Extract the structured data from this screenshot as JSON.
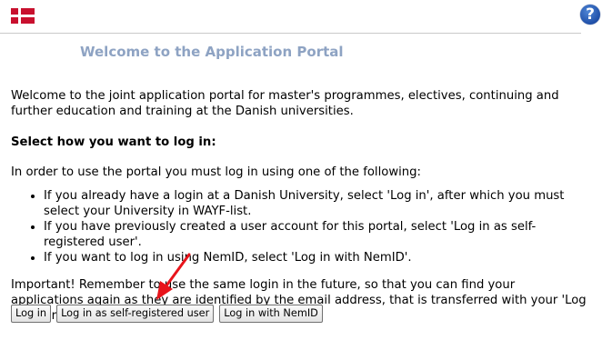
{
  "header": {
    "flag_icon": "danish-flag-icon",
    "help_icon": "help-icon",
    "help_glyph": "?"
  },
  "title": "Welcome to the Application Portal",
  "intro": "Welcome to the joint application portal for master's programmes, electives, continuing and further education and training at the Danish universities.",
  "login_heading": "Select how you want to log in:",
  "instruction": "In order to use the portal you must log in using one of the following:",
  "options": [
    "If you already have a login at a Danish University, select 'Log in', after which you must select your University in WAYF-list.",
    "If you have previously created a user account for this portal, select 'Log in as self-registered user'.",
    "If you want to log in using NemID, select 'Log in with NemID'."
  ],
  "important": "Important! Remember to use the same login in the future, so that you can find your applications again as they are identified by the email address, that is transferred with your 'Log in' information.",
  "buttons": {
    "login": "Log in",
    "self_registered": "Log in as self-registered user",
    "nemid": "Log in with NemID"
  },
  "colors": {
    "title": "#8ea3c3",
    "flag_red": "#c8102e",
    "help_blue": "#1f4fa8",
    "arrow_red": "#e8141b"
  }
}
